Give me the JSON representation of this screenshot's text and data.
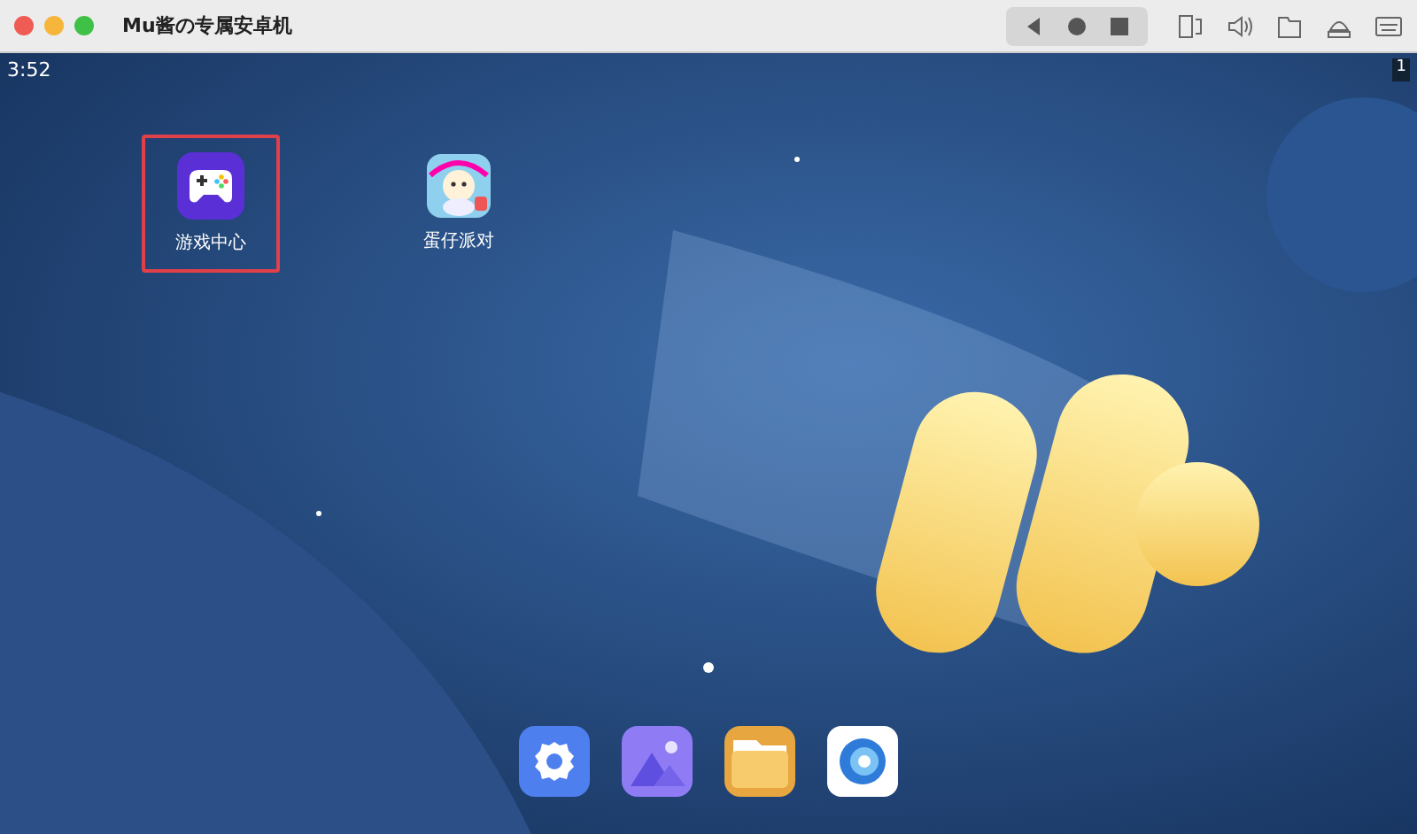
{
  "window": {
    "title": "Mu酱の专属安卓机"
  },
  "status_bar": {
    "time": "3:52",
    "badge": "1"
  },
  "desktop_icons": [
    {
      "label": "游戏中心",
      "kind": "gamepad",
      "selected": true
    },
    {
      "label": "蛋仔派对",
      "kind": "game",
      "selected": false
    }
  ],
  "dock": [
    {
      "kind": "settings"
    },
    {
      "kind": "gallery"
    },
    {
      "kind": "files"
    },
    {
      "kind": "browser"
    }
  ]
}
